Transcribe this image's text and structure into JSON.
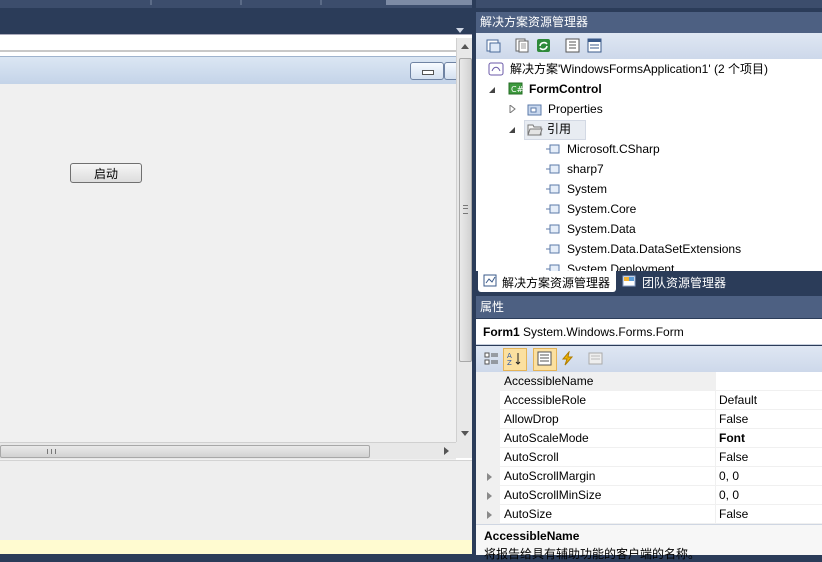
{
  "designer": {
    "start_button_label": "启动"
  },
  "solution_explorer": {
    "title": "解决方案资源管理器",
    "solution_label": "解决方案'WindowsFormsApplication1' (2 个项目)",
    "project_label": "FormControl",
    "properties_label": "Properties",
    "references_label": "引用",
    "references": [
      "Microsoft.CSharp",
      "sharp7",
      "System",
      "System.Core",
      "System.Data",
      "System.Data.DataSetExtensions",
      "System.Deployment"
    ],
    "tabs": {
      "solution_tab": "解决方案资源管理器",
      "team_tab": "团队资源管理器"
    }
  },
  "properties": {
    "title": "属性",
    "object_name": "Form1",
    "object_type": "System.Windows.Forms.Form",
    "rows": [
      {
        "name": "AccessibleName",
        "value": ""
      },
      {
        "name": "AccessibleRole",
        "value": "Default"
      },
      {
        "name": "AllowDrop",
        "value": "False"
      },
      {
        "name": "AutoScaleMode",
        "value": "Font"
      },
      {
        "name": "AutoScroll",
        "value": "False"
      },
      {
        "name": "AutoScrollMargin",
        "value": "0, 0"
      },
      {
        "name": "AutoScrollMinSize",
        "value": "0, 0"
      },
      {
        "name": "AutoSize",
        "value": "False"
      }
    ],
    "description_title": "AccessibleName",
    "description_text": "将报告给具有辅助功能的客户端的名称。"
  }
}
